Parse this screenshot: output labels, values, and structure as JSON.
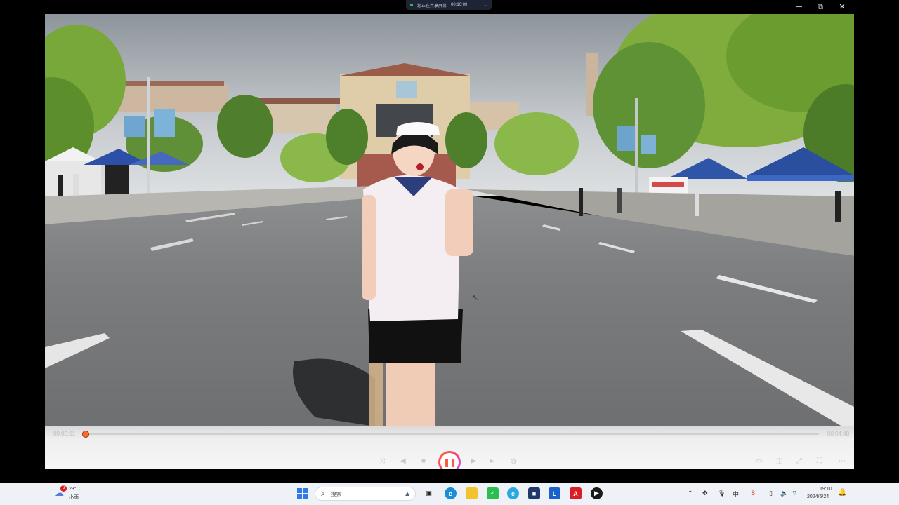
{
  "window": {
    "share_bar": {
      "label": "您正在共享屏幕",
      "elapsed": "00:10:09"
    },
    "controls": {
      "minimize": "─",
      "maximize": "⧉",
      "close": "✕"
    }
  },
  "player": {
    "time_current": "00:00:01",
    "time_total": "00:04:48",
    "progress": 0.0,
    "state": "playing",
    "accent": "#ff6a26",
    "buttons": [
      "shuffle-icon",
      "previous-icon",
      "stop-icon",
      "pause-icon",
      "next-icon",
      "end-icon",
      "volume-icon"
    ],
    "right_buttons": [
      "subtitle-icon",
      "screenshot-icon",
      "pip-icon",
      "fullscreen-icon",
      "more-icon"
    ]
  },
  "taskbar": {
    "weather": {
      "temp": "23°C",
      "condition": "小雨",
      "badge": "3"
    },
    "search_placeholder": "搜索",
    "apps": [
      "task-view-icon",
      "edge-icon",
      "file-explorer-icon",
      "wechat-icon",
      "ie-icon",
      "store-icon",
      "lenovo-icon",
      "acrobat-icon",
      "player-icon"
    ],
    "clock": {
      "time": "19:10",
      "date": "2024/6/24"
    }
  }
}
